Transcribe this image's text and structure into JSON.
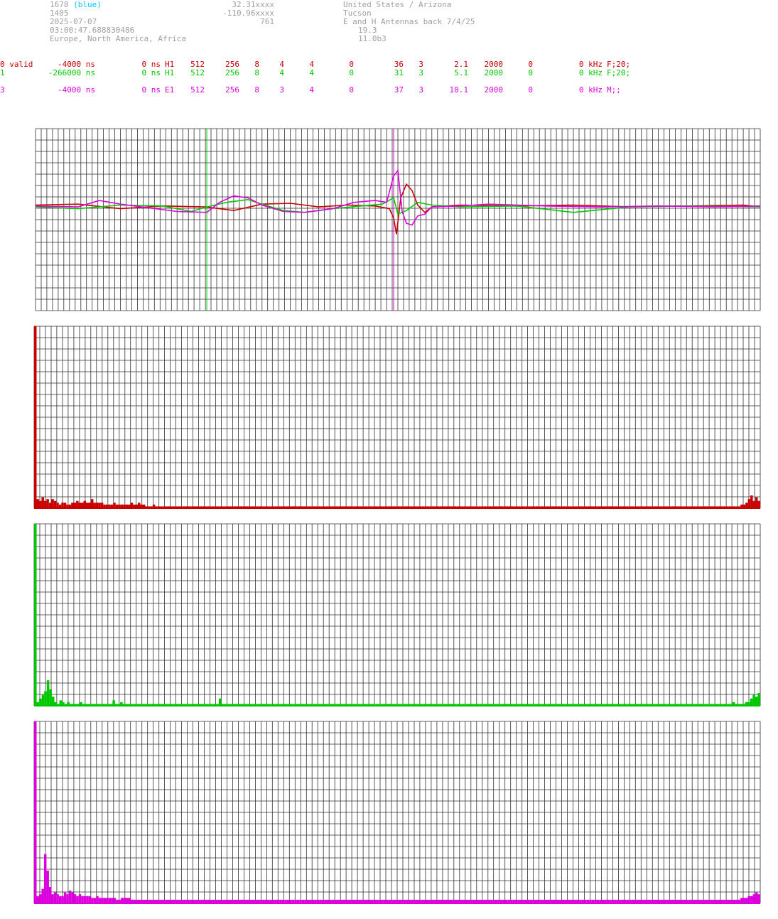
{
  "header": {
    "station_id": "1678",
    "station_color": "(blue)",
    "line2": "1405",
    "date": "2025-07-07",
    "time": "03:00:47.688830486",
    "regions": "Europe, North America, Africa",
    "lat": "32.31xxxx",
    "lon": "-110.96xxxx",
    "alt": "761",
    "country": "United States / Arizona",
    "city": "Tucson",
    "note": "E and H Antennas back 7/4/25",
    "val1": "19.3",
    "val2": "11.0b3"
  },
  "channels": [
    {
      "id": "0 valid",
      "offset": "-4000 ns",
      "delay": "0 ns",
      "ant": "H1",
      "c1": "512",
      "c2": "256",
      "c3": "8",
      "c4": "4",
      "c5": "4",
      "c6": "0",
      "c7": "36",
      "c8": "3",
      "c9": "2.1",
      "c10": "2000",
      "c11": "0",
      "freq": "0 kHz",
      "filter": "F;20;",
      "color": "#c80000"
    },
    {
      "id": "1",
      "offset": "-266000 ns",
      "delay": "0 ns",
      "ant": "H1",
      "c1": "512",
      "c2": "256",
      "c3": "8",
      "c4": "4",
      "c5": "4",
      "c6": "0",
      "c7": "31",
      "c8": "3",
      "c9": "5.1",
      "c10": "2000",
      "c11": "0",
      "freq": "0 kHz",
      "filter": "F;20;",
      "color": "#00c800"
    },
    {
      "id": "3",
      "offset": "-4000 ns",
      "delay": "0 ns",
      "ant": "E1",
      "c1": "512",
      "c2": "256",
      "c3": "8",
      "c4": "3",
      "c5": "4",
      "c6": "0",
      "c7": "37",
      "c8": "3",
      "c9": "10.1",
      "c10": "2000",
      "c11": "0",
      "freq": "0 kHz",
      "filter": "M;;",
      "color": "#dc00dc"
    }
  ],
  "chart_data": [
    {
      "type": "line",
      "title": "",
      "description_units": "samples vs amplitude (arbitrary)",
      "xlim": [
        0,
        512
      ],
      "ylim": [
        -1,
        1
      ],
      "grid": true,
      "markers": [
        {
          "series": "1",
          "x": 121,
          "color": "#00c800"
        },
        {
          "series": "3",
          "x": 253,
          "color": "#dc00dc"
        }
      ],
      "series": [
        {
          "name": "0",
          "color": "#c80000",
          "points": [
            [
              0,
              0.02
            ],
            [
              30,
              0.03
            ],
            [
              60,
              -0.02
            ],
            [
              90,
              0.01
            ],
            [
              120,
              0.0
            ],
            [
              140,
              -0.04
            ],
            [
              160,
              0.03
            ],
            [
              180,
              0.04
            ],
            [
              200,
              0.0
            ],
            [
              220,
              0.02
            ],
            [
              240,
              0.01
            ],
            [
              250,
              -0.02
            ],
            [
              253,
              -0.12
            ],
            [
              255,
              -0.3
            ],
            [
              258,
              0.1
            ],
            [
              262,
              0.25
            ],
            [
              266,
              0.18
            ],
            [
              270,
              0.02
            ],
            [
              275,
              -0.06
            ],
            [
              280,
              0.0
            ],
            [
              300,
              0.02
            ],
            [
              340,
              0.01
            ],
            [
              380,
              0.02
            ],
            [
              420,
              0.0
            ],
            [
              460,
              0.01
            ],
            [
              500,
              0.02
            ],
            [
              512,
              0.0
            ]
          ]
        },
        {
          "name": "1",
          "color": "#00c800",
          "points": [
            [
              0,
              0.0
            ],
            [
              30,
              -0.02
            ],
            [
              60,
              0.02
            ],
            [
              90,
              0.01
            ],
            [
              110,
              -0.05
            ],
            [
              121,
              0.0
            ],
            [
              135,
              0.05
            ],
            [
              150,
              0.08
            ],
            [
              160,
              0.03
            ],
            [
              175,
              -0.04
            ],
            [
              190,
              -0.06
            ],
            [
              210,
              -0.02
            ],
            [
              230,
              0.01
            ],
            [
              245,
              0.03
            ],
            [
              253,
              0.1
            ],
            [
              256,
              -0.08
            ],
            [
              262,
              -0.04
            ],
            [
              270,
              0.05
            ],
            [
              280,
              0.02
            ],
            [
              300,
              0.0
            ],
            [
              340,
              0.01
            ],
            [
              380,
              -0.06
            ],
            [
              420,
              0.0
            ],
            [
              460,
              0.01
            ],
            [
              512,
              0.0
            ]
          ]
        },
        {
          "name": "3",
          "color": "#dc00dc",
          "points": [
            [
              0,
              0.01
            ],
            [
              30,
              0.0
            ],
            [
              45,
              0.07
            ],
            [
              60,
              0.03
            ],
            [
              80,
              -0.01
            ],
            [
              100,
              -0.05
            ],
            [
              121,
              -0.06
            ],
            [
              130,
              0.05
            ],
            [
              140,
              0.12
            ],
            [
              150,
              0.1
            ],
            [
              160,
              0.02
            ],
            [
              175,
              -0.05
            ],
            [
              190,
              -0.06
            ],
            [
              210,
              -0.02
            ],
            [
              225,
              0.05
            ],
            [
              240,
              0.07
            ],
            [
              248,
              0.05
            ],
            [
              253,
              0.34
            ],
            [
              256,
              0.4
            ],
            [
              259,
              -0.05
            ],
            [
              262,
              -0.18
            ],
            [
              266,
              -0.2
            ],
            [
              270,
              -0.1
            ],
            [
              275,
              -0.08
            ],
            [
              280,
              0.0
            ],
            [
              300,
              0.01
            ],
            [
              320,
              0.03
            ],
            [
              360,
              0.01
            ],
            [
              400,
              0.0
            ],
            [
              440,
              0.01
            ],
            [
              480,
              0.0
            ],
            [
              512,
              0.01
            ]
          ]
        }
      ]
    },
    {
      "type": "bar",
      "title": "",
      "series_name": "0",
      "color": "#c80000",
      "ylim": [
        0,
        100
      ],
      "values": [
        100,
        5,
        4,
        6,
        4,
        5,
        3,
        5,
        4,
        3,
        2,
        3,
        3,
        2,
        2,
        3,
        3,
        4,
        3,
        3,
        4,
        3,
        3,
        5,
        3,
        3,
        3,
        3,
        2,
        2,
        2,
        2,
        3,
        2,
        2,
        2,
        2,
        2,
        2,
        3,
        2,
        2,
        3,
        2,
        2,
        1,
        1,
        1,
        2,
        1,
        1,
        1,
        1,
        1,
        1,
        1,
        1,
        1,
        1,
        1,
        1,
        1,
        1,
        1,
        1,
        1,
        1,
        1,
        1,
        1,
        1,
        1,
        1,
        1,
        1,
        1,
        1,
        1,
        1,
        1,
        1,
        1,
        1,
        1,
        1,
        1,
        1,
        1,
        1,
        1,
        1,
        1,
        1,
        1,
        1,
        1,
        1,
        1,
        1,
        1,
        1,
        1,
        1,
        1,
        1,
        1,
        1,
        1,
        1,
        1,
        1,
        1,
        1,
        1,
        1,
        1,
        1,
        1,
        1,
        1,
        1,
        1,
        1,
        1,
        1,
        1,
        1,
        1,
        1,
        1,
        1,
        1,
        1,
        1,
        1,
        1,
        1,
        1,
        1,
        1,
        1,
        1,
        1,
        1,
        1,
        1,
        1,
        1,
        1,
        1,
        1,
        1,
        1,
        1,
        1,
        1,
        1,
        1,
        1,
        1,
        1,
        1,
        1,
        1,
        1,
        1,
        1,
        1,
        1,
        1,
        1,
        1,
        1,
        1,
        1,
        1,
        1,
        1,
        1,
        1,
        1,
        1,
        1,
        1,
        1,
        1,
        1,
        1,
        1,
        1,
        1,
        1,
        1,
        1,
        1,
        1,
        1,
        1,
        1,
        1,
        1,
        1,
        1,
        1,
        1,
        1,
        1,
        1,
        1,
        1,
        1,
        1,
        1,
        1,
        1,
        1,
        1,
        1,
        1,
        1,
        1,
        1,
        1,
        1,
        1,
        1,
        1,
        1,
        1,
        1,
        1,
        1,
        1,
        1,
        1,
        1,
        1,
        1,
        1,
        1,
        1,
        1,
        1,
        1,
        1,
        1,
        1,
        1,
        1,
        1,
        1,
        1,
        1,
        1,
        1,
        1,
        1,
        1,
        1,
        1,
        1,
        1,
        1,
        1,
        1,
        1,
        1,
        1,
        1,
        1,
        1,
        1,
        1,
        1,
        1,
        1,
        1,
        1,
        1,
        1,
        1,
        1,
        1,
        1,
        1,
        1,
        2,
        2,
        3,
        5,
        7,
        4,
        6,
        4
      ]
    },
    {
      "type": "bar",
      "title": "",
      "series_name": "1",
      "color": "#00c800",
      "ylim": [
        0,
        100
      ],
      "values": [
        100,
        2,
        4,
        6,
        8,
        14,
        9,
        5,
        2,
        1,
        3,
        2,
        1,
        2,
        1,
        1,
        1,
        1,
        2,
        1,
        1,
        1,
        1,
        1,
        1,
        1,
        1,
        1,
        1,
        1,
        1,
        3,
        1,
        1,
        2,
        1,
        1,
        1,
        1,
        1,
        1,
        1,
        1,
        1,
        1,
        1,
        1,
        1,
        1,
        1,
        1,
        1,
        1,
        1,
        1,
        1,
        1,
        1,
        1,
        1,
        1,
        1,
        1,
        1,
        1,
        1,
        1,
        1,
        1,
        1,
        1,
        1,
        1,
        4,
        1,
        1,
        1,
        1,
        1,
        1,
        1,
        1,
        1,
        1,
        1,
        1,
        1,
        1,
        1,
        1,
        1,
        1,
        1,
        1,
        1,
        1,
        1,
        1,
        1,
        1,
        1,
        1,
        1,
        1,
        1,
        1,
        1,
        1,
        1,
        1,
        1,
        1,
        1,
        1,
        1,
        1,
        1,
        1,
        1,
        1,
        1,
        1,
        1,
        1,
        1,
        1,
        1,
        1,
        1,
        1,
        1,
        1,
        1,
        1,
        1,
        1,
        1,
        1,
        1,
        1,
        1,
        1,
        1,
        1,
        1,
        1,
        1,
        1,
        1,
        1,
        1,
        1,
        1,
        1,
        1,
        1,
        1,
        1,
        1,
        1,
        1,
        1,
        1,
        1,
        1,
        1,
        1,
        1,
        1,
        1,
        1,
        1,
        1,
        1,
        1,
        1,
        1,
        1,
        1,
        1,
        1,
        1,
        1,
        1,
        1,
        1,
        1,
        1,
        1,
        1,
        1,
        1,
        1,
        1,
        1,
        1,
        1,
        1,
        1,
        1,
        1,
        1,
        1,
        1,
        1,
        1,
        1,
        1,
        1,
        1,
        1,
        1,
        1,
        1,
        1,
        1,
        1,
        1,
        1,
        1,
        1,
        1,
        1,
        1,
        1,
        1,
        1,
        1,
        1,
        1,
        1,
        1,
        1,
        1,
        1,
        1,
        1,
        1,
        1,
        1,
        1,
        1,
        1,
        1,
        1,
        1,
        1,
        1,
        1,
        1,
        1,
        1,
        1,
        1,
        1,
        1,
        1,
        1,
        1,
        1,
        1,
        1,
        1,
        1,
        1,
        1,
        1,
        1,
        1,
        1,
        1,
        1,
        1,
        1,
        1,
        1,
        2,
        1,
        1,
        1,
        1,
        2,
        2,
        4,
        6,
        5,
        7
      ]
    },
    {
      "type": "bar",
      "title": "",
      "series_name": "3",
      "color": "#dc00dc",
      "ylim": [
        0,
        100
      ],
      "values": [
        100,
        4,
        5,
        8,
        27,
        18,
        9,
        5,
        6,
        5,
        4,
        4,
        6,
        5,
        7,
        6,
        5,
        4,
        5,
        4,
        4,
        4,
        4,
        3,
        3,
        4,
        3,
        3,
        3,
        3,
        3,
        3,
        3,
        2,
        2,
        3,
        3,
        3,
        3,
        2,
        2,
        2,
        2,
        2,
        2,
        2,
        2,
        2,
        2,
        2,
        2,
        2,
        2,
        2,
        2,
        2,
        2,
        2,
        2,
        2,
        2,
        2,
        2,
        2,
        2,
        2,
        2,
        2,
        2,
        2,
        2,
        2,
        2,
        2,
        2,
        2,
        2,
        2,
        2,
        2,
        2,
        2,
        2,
        2,
        2,
        2,
        2,
        2,
        2,
        2,
        2,
        2,
        2,
        2,
        2,
        2,
        2,
        2,
        2,
        2,
        2,
        2,
        2,
        2,
        2,
        2,
        2,
        2,
        2,
        2,
        2,
        2,
        2,
        2,
        2,
        2,
        2,
        2,
        2,
        2,
        2,
        2,
        2,
        2,
        2,
        2,
        2,
        2,
        2,
        2,
        2,
        2,
        2,
        2,
        2,
        2,
        2,
        2,
        2,
        2,
        2,
        2,
        2,
        2,
        2,
        2,
        2,
        2,
        2,
        2,
        2,
        2,
        2,
        2,
        2,
        2,
        2,
        2,
        2,
        2,
        2,
        2,
        2,
        2,
        2,
        2,
        2,
        2,
        2,
        2,
        2,
        2,
        2,
        2,
        2,
        2,
        2,
        2,
        2,
        2,
        2,
        2,
        2,
        2,
        2,
        2,
        2,
        2,
        2,
        2,
        2,
        2,
        2,
        2,
        2,
        2,
        2,
        2,
        2,
        2,
        2,
        2,
        2,
        2,
        2,
        2,
        2,
        2,
        2,
        2,
        2,
        2,
        2,
        2,
        2,
        2,
        2,
        2,
        2,
        2,
        2,
        2,
        2,
        2,
        2,
        2,
        2,
        2,
        2,
        2,
        2,
        2,
        2,
        2,
        2,
        2,
        2,
        2,
        2,
        2,
        2,
        2,
        2,
        2,
        2,
        2,
        2,
        2,
        2,
        2,
        2,
        2,
        2,
        2,
        2,
        2,
        2,
        2,
        2,
        2,
        2,
        2,
        2,
        2,
        2,
        2,
        2,
        2,
        2,
        2,
        2,
        2,
        2,
        2,
        2,
        2,
        2,
        2,
        2,
        2,
        2,
        2,
        2,
        2,
        2,
        3,
        3,
        3,
        4,
        4,
        5,
        6,
        5
      ]
    }
  ]
}
